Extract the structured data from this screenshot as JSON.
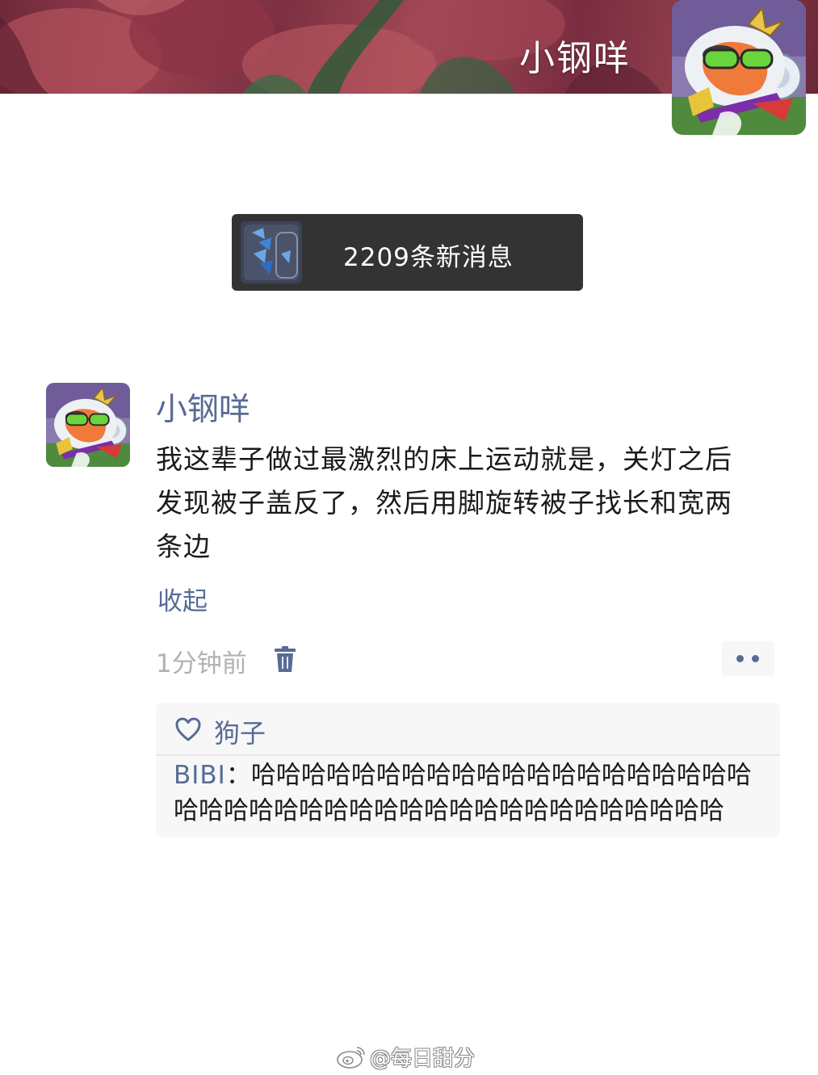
{
  "header": {
    "username": "小钢咩"
  },
  "notification": {
    "text": "2209条新消息"
  },
  "post": {
    "author": "小钢咩",
    "text": "我这辈子做过最激烈的床上运动就是，关灯之后发现被子盖反了，然后用脚旋转被子找长和宽两条边",
    "collapse_label": "收起",
    "time": "1分钟前"
  },
  "interactions": {
    "likes": [
      "狗子"
    ],
    "comments": [
      {
        "author": "BIBI",
        "separator": "：",
        "text": "哈哈哈哈哈哈哈哈哈哈哈哈哈哈哈哈哈哈哈哈哈哈哈哈哈哈哈哈哈哈哈哈哈哈哈哈哈哈哈哈哈哈"
      }
    ]
  },
  "watermark": {
    "text": "@每日甜分"
  },
  "icons": {
    "delete": "trash-icon",
    "more": "more-dots-icon",
    "like": "heart-outline-icon",
    "watermark": "weibo-logo-icon"
  },
  "colors": {
    "link_blue": "#576b95",
    "notify_bg": "#333333",
    "interaction_bg": "#f7f7f7",
    "muted_text": "#b2b2b2"
  }
}
